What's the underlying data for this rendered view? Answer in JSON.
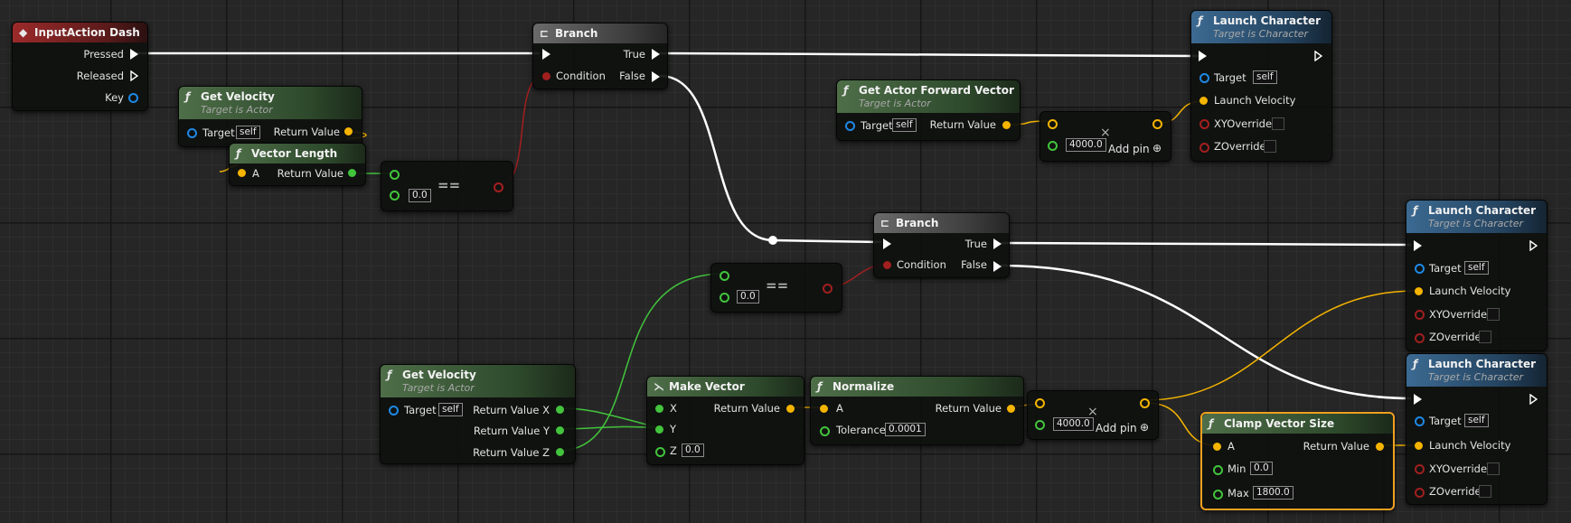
{
  "colors": {
    "exec_wire": "#ffffff",
    "vector_wire": "#f5b400",
    "float_wire": "#42c43c",
    "bool_wire": "#a11f1f",
    "object_pin": "#1e88e5",
    "selection": "#f0a020"
  },
  "nodes": {
    "input_dash": {
      "title": "InputAction Dash",
      "icon": "input-event-icon",
      "pressed": "Pressed",
      "released": "Released",
      "key": "Key"
    },
    "get_velocity_1": {
      "title": "Get Velocity",
      "subtitle": "Target is Actor",
      "target": "Target",
      "target_value": "self",
      "return_value": "Return Value"
    },
    "vector_length": {
      "title": "Vector Length",
      "a": "A",
      "return_value": "Return Value"
    },
    "eq_1": {
      "value": "0.0",
      "symbol": "=="
    },
    "branch_1": {
      "title": "Branch",
      "true_label": "True",
      "condition": "Condition",
      "false_label": "False"
    },
    "get_forward": {
      "title": "Get Actor Forward Vector",
      "subtitle": "Target is Actor",
      "target": "Target",
      "target_value": "self",
      "return_value": "Return Value"
    },
    "mult_1": {
      "value": "4000.0",
      "add_pin": "Add pin",
      "symbol": "×"
    },
    "launch_1": {
      "title": "Launch Character",
      "subtitle": "Target is Character",
      "target": "Target",
      "target_value": "self",
      "launch_velocity": "Launch Velocity",
      "xy_override": "XYOverride",
      "z_override": "ZOverride"
    },
    "branch_2": {
      "title": "Branch",
      "true_label": "True",
      "condition": "Condition",
      "false_label": "False"
    },
    "eq_2": {
      "value": "0.0",
      "symbol": "=="
    },
    "launch_2": {
      "title": "Launch Character",
      "subtitle": "Target is Character",
      "target": "Target",
      "target_value": "self",
      "launch_velocity": "Launch Velocity",
      "xy_override": "XYOverride",
      "z_override": "ZOverride"
    },
    "get_velocity_2": {
      "title": "Get Velocity",
      "subtitle": "Target is Actor",
      "target": "Target",
      "target_value": "self",
      "return_x": "Return Value X",
      "return_y": "Return Value Y",
      "return_z": "Return Value Z"
    },
    "make_vector": {
      "title": "Make Vector",
      "x": "X",
      "y": "Y",
      "z": "Z",
      "z_value": "0.0",
      "return_value": "Return Value"
    },
    "normalize": {
      "title": "Normalize",
      "a": "A",
      "tolerance": "Tolerance",
      "tolerance_value": "0.0001",
      "return_value": "Return Value"
    },
    "mult_2": {
      "value": "4000.0",
      "add_pin": "Add pin",
      "symbol": "×"
    },
    "clamp": {
      "title": "Clamp Vector Size",
      "a": "A",
      "min": "Min",
      "min_value": "0.0",
      "max": "Max",
      "max_value": "1800.0",
      "return_value": "Return Value"
    },
    "launch_3": {
      "title": "Launch Character",
      "subtitle": "Target is Character",
      "target": "Target",
      "target_value": "self",
      "launch_velocity": "Launch Velocity",
      "xy_override": "XYOverride",
      "z_override": "ZOverride"
    }
  }
}
